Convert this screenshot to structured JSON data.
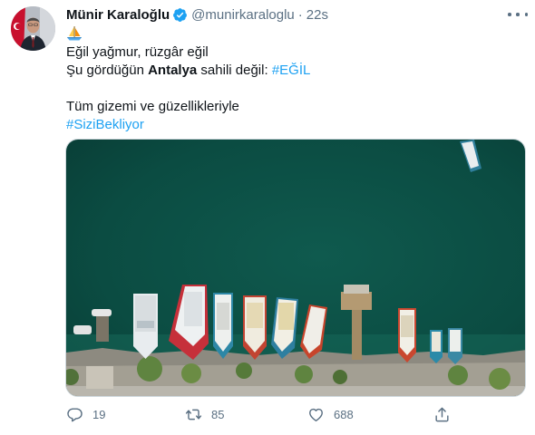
{
  "tweet": {
    "author_name": "Münir Karaloğlu",
    "author_handle": "@munirkaraloglu",
    "separator": "·",
    "timestamp": "22s",
    "lines": {
      "line2": "Eğil yağmur, rüzgâr eğil",
      "line3_pre": "Şu gördüğün ",
      "line3_bold": "Antalya",
      "line3_mid": " sahili değil: ",
      "line3_tag": "#EĞİL",
      "line5": "Tüm gizemi ve güzellikleriyle",
      "line6_tag": "#SiziBekliyor"
    },
    "icons": {
      "verified": "verified-badge-icon",
      "more": "more-options-icon",
      "emoji": "sailboat-emoji-icon",
      "reply": "reply-icon",
      "retweet": "retweet-icon",
      "like": "heart-icon",
      "share": "share-icon"
    }
  },
  "actions": {
    "reply_count": "19",
    "retweet_count": "85",
    "like_count": "688"
  },
  "colors": {
    "link": "#1da1f2",
    "secondary_text": "#5b7083",
    "sea": "#0c4f45"
  }
}
